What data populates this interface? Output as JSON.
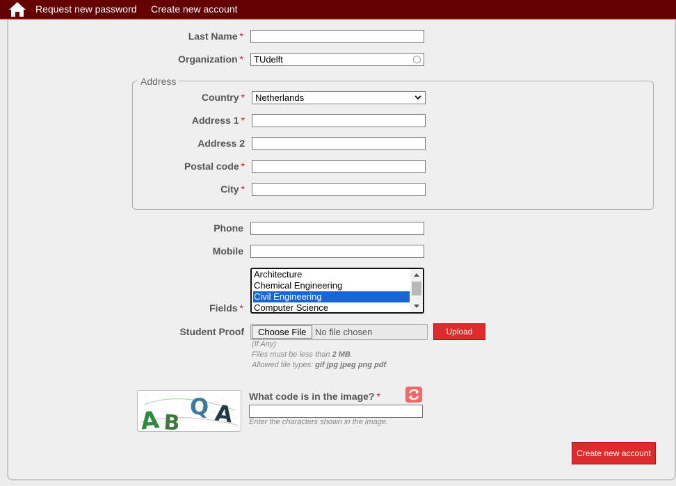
{
  "nav": {
    "home_icon": "home-icon",
    "links": [
      "Request new password",
      "Create new account"
    ]
  },
  "form": {
    "last_name": {
      "label": "Last Name",
      "value": ""
    },
    "organization": {
      "label": "Organization",
      "value": "TUdelft"
    },
    "address": {
      "legend": "Address",
      "country": {
        "label": "Country",
        "value": "Netherlands"
      },
      "address1": {
        "label": "Address 1",
        "value": ""
      },
      "address2": {
        "label": "Address 2",
        "value": ""
      },
      "postal_code": {
        "label": "Postal code",
        "value": ""
      },
      "city": {
        "label": "City",
        "value": ""
      }
    },
    "phone": {
      "label": "Phone",
      "value": ""
    },
    "mobile": {
      "label": "Mobile",
      "value": ""
    },
    "fields": {
      "label": "Fields",
      "options": [
        "Architecture",
        "Chemical Engineering",
        "Civil Engineering",
        "Computer Science"
      ],
      "selected": "Civil Engineering"
    },
    "student_proof": {
      "label": "Student Proof",
      "choose_file": "Choose File",
      "no_file": "No file chosen",
      "upload": "Upload",
      "hint_optional": "(If Any)",
      "hint_size_prefix": "Files must be less than ",
      "hint_size_value": "2 MB",
      "hint_size_suffix": ".",
      "hint_types_prefix": "Allowed file types: ",
      "hint_types_value": "gif jpg jpeg png pdf",
      "hint_types_suffix": "."
    },
    "captcha": {
      "question": "What code is in the image?",
      "hint": "Enter the characters shown in the image.",
      "value": "",
      "image_letters": [
        "A",
        "B",
        "Q",
        "A"
      ],
      "refresh_icon": "refresh-icon"
    },
    "required_marker": "*",
    "submit": "Create new account"
  },
  "colors": {
    "topbar": "#640000",
    "topbar_accent": "#d9a23c",
    "required": "#c81e1e",
    "button": "#dd2a2a",
    "selection": "#1a64d0"
  }
}
